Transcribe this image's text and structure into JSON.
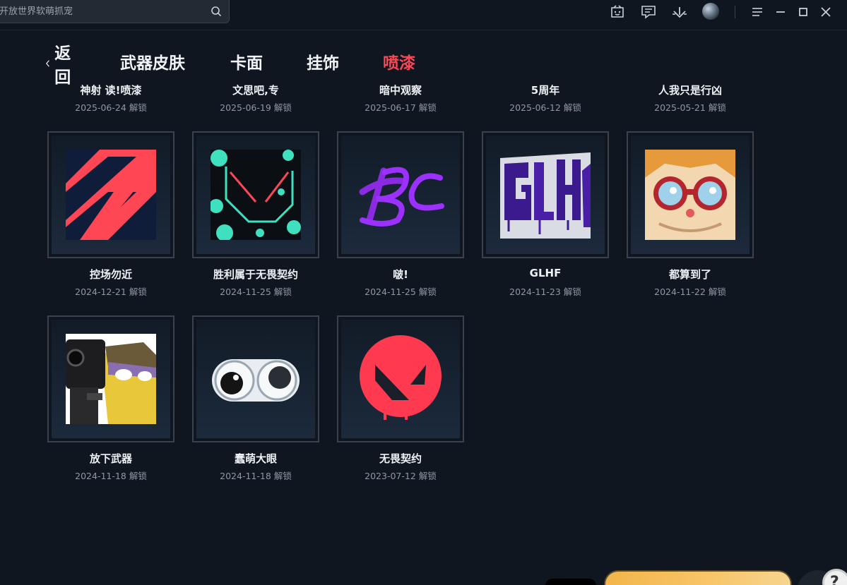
{
  "search": {
    "placeholder": "开放世界软萌抓宠"
  },
  "nav": {
    "back_label": "返回",
    "tabs": [
      {
        "label": "武器皮肤"
      },
      {
        "label": "卡面"
      },
      {
        "label": "挂饰"
      },
      {
        "label": "喷漆",
        "active": true
      }
    ]
  },
  "unlock_label": "解锁",
  "clipped_row": [
    {
      "name": "神射 读!喷漆",
      "date": "2025-06-24"
    },
    {
      "name": "文思吧,专",
      "date": "2025-06-19"
    },
    {
      "name": "暗中观察",
      "date": "2025-06-17"
    },
    {
      "name": "5周年",
      "date": "2025-06-12"
    },
    {
      "name": "人我只是行凶",
      "date": "2025-05-21"
    }
  ],
  "sprays": [
    {
      "name": "控场勿近",
      "date": "2024-12-21",
      "icon": "control-chevrons-art"
    },
    {
      "name": "胜利属于无畏契约",
      "date": "2024-11-25",
      "icon": "valorant-splash-art"
    },
    {
      "name": "啵!",
      "date": "2024-11-25",
      "icon": "purple-graffiti-art"
    },
    {
      "name": "GLHF",
      "date": "2024-11-23",
      "icon": "glhf-graffiti-art"
    },
    {
      "name": "都算到了",
      "date": "2024-11-22",
      "icon": "goggles-face-art"
    },
    {
      "name": "放下武器",
      "date": "2024-11-18",
      "icon": "pistol-character-art"
    },
    {
      "name": "蠢萌大眼",
      "date": "2024-11-18",
      "icon": "googly-eyes-art"
    },
    {
      "name": "无畏契约",
      "date": "2023-07-12",
      "icon": "valorant-logo-art"
    }
  ],
  "colors": {
    "accent": "#ff4655",
    "background": "#0f1620",
    "cell_border": "#3a4250"
  }
}
